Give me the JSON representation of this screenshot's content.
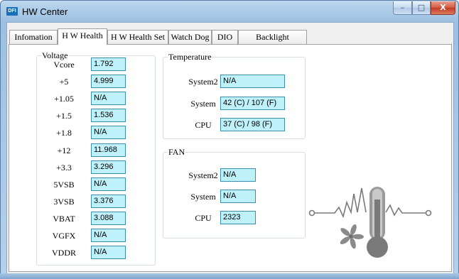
{
  "window": {
    "title": "HW Center",
    "icon_text": "DFI",
    "controls": {
      "minimize": "–",
      "maximize": "□",
      "close": "X"
    }
  },
  "tabs": [
    {
      "label": "Infomation"
    },
    {
      "label": "H W Health",
      "active": true
    },
    {
      "label": "H W Health Set"
    },
    {
      "label": "Watch Dog"
    },
    {
      "label": "DIO"
    },
    {
      "label": "Backlight"
    }
  ],
  "voltage": {
    "title": "Voltage",
    "rows": [
      {
        "label": "Vcore",
        "value": "1.792"
      },
      {
        "label": "+5",
        "value": "4.999"
      },
      {
        "label": "+1.05",
        "value": "N/A"
      },
      {
        "label": "+1.5",
        "value": "1.536"
      },
      {
        "label": "+1.8",
        "value": "N/A"
      },
      {
        "label": "+12",
        "value": "11.968"
      },
      {
        "label": "+3.3",
        "value": "3.296"
      },
      {
        "label": "5VSB",
        "value": "N/A"
      },
      {
        "label": "3VSB",
        "value": "3.376"
      },
      {
        "label": "VBAT",
        "value": "3.088"
      },
      {
        "label": "VGFX",
        "value": "N/A"
      },
      {
        "label": "VDDR",
        "value": "N/A"
      }
    ]
  },
  "temperature": {
    "title": "Temperature",
    "rows": [
      {
        "label": "System2",
        "value": "N/A"
      },
      {
        "label": "System",
        "value": "42 (C) / 107 (F)"
      },
      {
        "label": "CPU",
        "value": "37 (C) / 98 (F)"
      }
    ]
  },
  "fan": {
    "title": "FAN",
    "rows": [
      {
        "label": "System2",
        "value": "N/A"
      },
      {
        "label": "System",
        "value": "N/A"
      },
      {
        "label": "CPU",
        "value": "2323"
      }
    ]
  },
  "illustration": {
    "icons": [
      "fan-icon",
      "thermometer-icon",
      "waveform-icon"
    ],
    "colors": {
      "gray": "#7a7a7a",
      "light": "#b8b8b8"
    }
  }
}
